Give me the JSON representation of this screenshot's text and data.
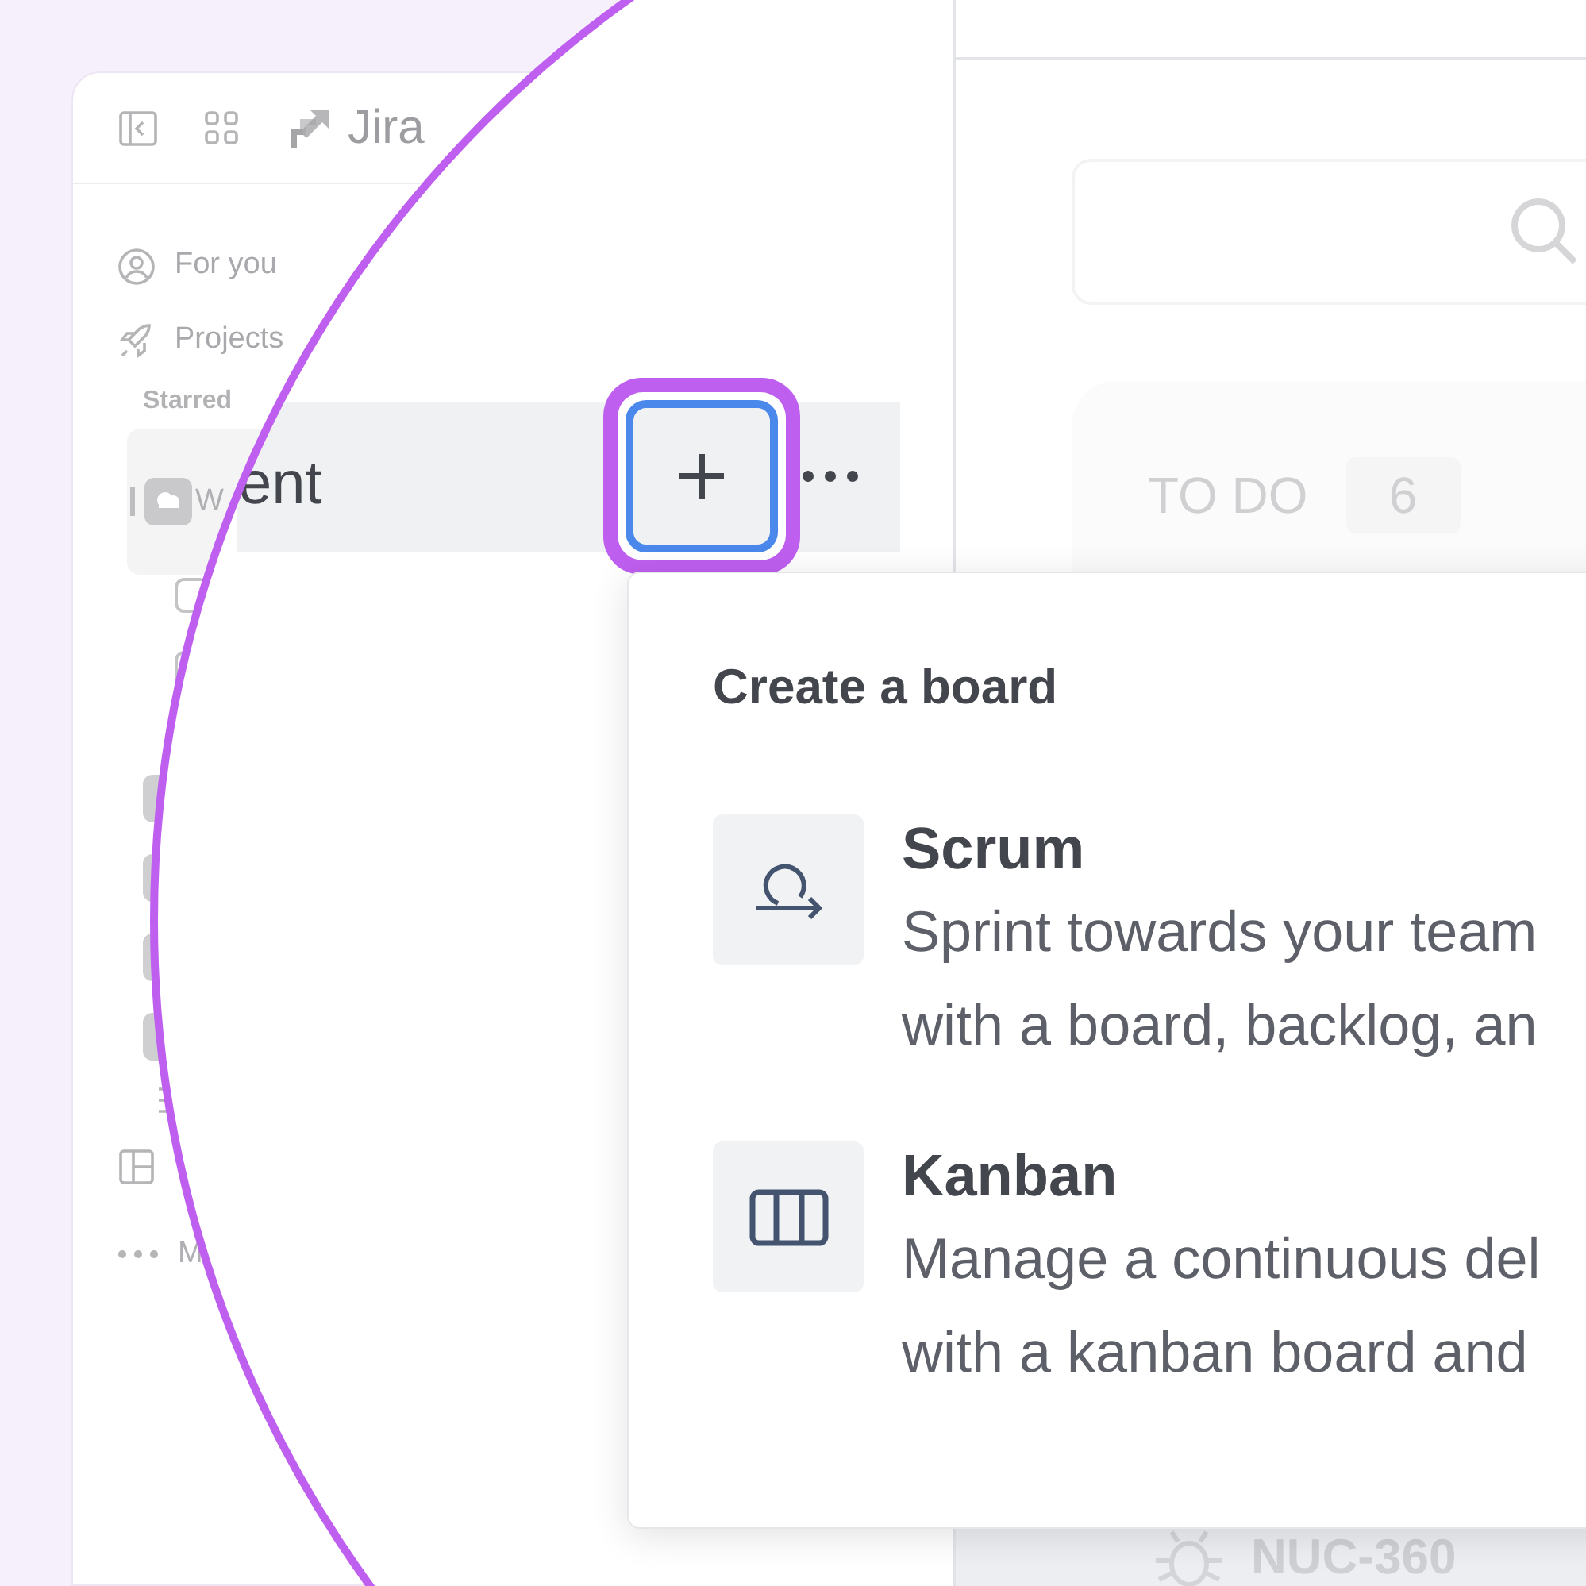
{
  "sidebar": {
    "app_name": "Jira",
    "nav_items": [
      {
        "label": "For you"
      },
      {
        "label": "Projects"
      }
    ],
    "section_label": "Starred",
    "starred_project": {
      "name": "W",
      "selected": true
    },
    "more_label": "M"
  },
  "magnified_row": {
    "name_fragment": "ent"
  },
  "board_menu": {
    "title": "Create a board",
    "options": [
      {
        "kind": "scrum",
        "title": "Scrum",
        "description_lines": [
          "Sprint towards your team",
          "with a board, backlog, an"
        ]
      },
      {
        "kind": "kanban",
        "title": "Kanban",
        "description_lines": [
          "Manage a continuous del",
          "with a kanban board and"
        ]
      }
    ]
  },
  "board": {
    "column": {
      "title": "TO DO",
      "count": "6"
    },
    "issue_key": "NUC-360"
  }
}
